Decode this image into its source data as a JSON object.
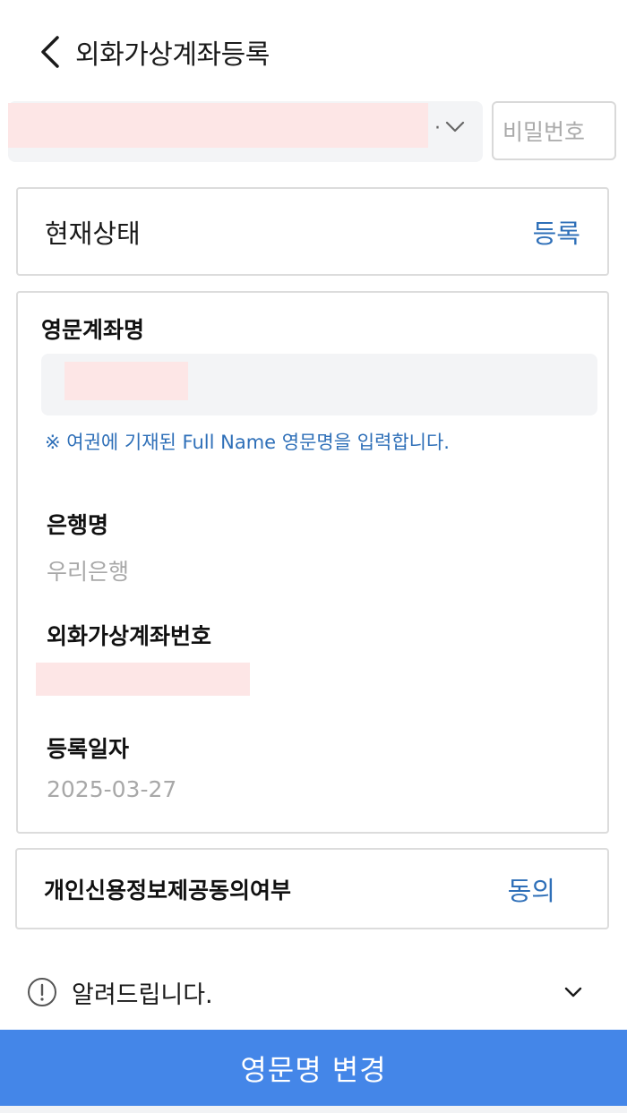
{
  "header": {
    "title": "외화가상계좌등록"
  },
  "account_select": {
    "separator": "·"
  },
  "password": {
    "placeholder": "비밀번호"
  },
  "status": {
    "label": "현재상태",
    "value": "등록"
  },
  "details": {
    "eng_name_label": "영문계좌명",
    "eng_name_notice": "※ 여권에 기재된 Full Name 영문명을 입력합니다.",
    "bank_label": "은행명",
    "bank_value": "우리은행",
    "account_label": "외화가상계좌번호",
    "date_label": "등록일자",
    "date_value": "2025-03-27"
  },
  "consent": {
    "label": "개인신용정보제공동의여부",
    "value": "동의"
  },
  "notice": {
    "title": "알려드립니다."
  },
  "primary_button": {
    "label": "영문명 변경"
  },
  "colors": {
    "accent_text": "#2e6fb8",
    "primary_button": "#4486e8",
    "redaction": "#fde6e6",
    "field_bg": "#f3f4f6"
  },
  "icons": [
    "back-arrow-icon",
    "chevron-down-icon",
    "info-circle-icon"
  ]
}
